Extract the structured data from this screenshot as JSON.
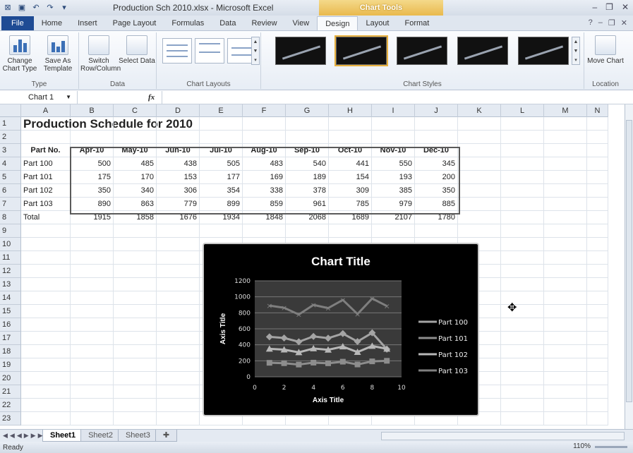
{
  "window": {
    "title": "Production Sch 2010.xlsx - Microsoft Excel",
    "contextual_tab_group": "Chart Tools",
    "controls": [
      "–",
      "❐",
      "✕"
    ]
  },
  "ribbon_tabs": [
    "File",
    "Home",
    "Insert",
    "Page Layout",
    "Formulas",
    "Data",
    "Review",
    "View",
    "Design",
    "Layout",
    "Format"
  ],
  "active_tab": "Design",
  "ribbon": {
    "type_group": {
      "label": "Type",
      "buttons": [
        "Change Chart Type",
        "Save As Template"
      ]
    },
    "data_group": {
      "label": "Data",
      "buttons": [
        "Switch Row/Column",
        "Select Data"
      ]
    },
    "layouts_group": {
      "label": "Chart Layouts"
    },
    "styles_group": {
      "label": "Chart Styles"
    },
    "location_group": {
      "label": "Location",
      "buttons": [
        "Move Chart"
      ]
    }
  },
  "formula_bar": {
    "name_box": "Chart 1",
    "fx": "fx",
    "value": ""
  },
  "columns": [
    "A",
    "B",
    "C",
    "D",
    "E",
    "F",
    "G",
    "H",
    "I",
    "J",
    "K",
    "L",
    "M",
    "N"
  ],
  "sheet": {
    "title": "Production Schedule for 2010",
    "headers": [
      "Part No.",
      "Apr-10",
      "May-10",
      "Jun-10",
      "Jul-10",
      "Aug-10",
      "Sep-10",
      "Oct-10",
      "Nov-10",
      "Dec-10"
    ],
    "rows": [
      [
        "Part 100",
        "500",
        "485",
        "438",
        "505",
        "483",
        "540",
        "441",
        "550",
        "345"
      ],
      [
        "Part 101",
        "175",
        "170",
        "153",
        "177",
        "169",
        "189",
        "154",
        "193",
        "200"
      ],
      [
        "Part 102",
        "350",
        "340",
        "306",
        "354",
        "338",
        "378",
        "309",
        "385",
        "350"
      ],
      [
        "Part 103",
        "890",
        "863",
        "779",
        "899",
        "859",
        "961",
        "785",
        "979",
        "885"
      ],
      [
        "Total",
        "1915",
        "1858",
        "1676",
        "1934",
        "1848",
        "2068",
        "1689",
        "2107",
        "1780"
      ]
    ],
    "row_numbers": [
      "1",
      "2",
      "3",
      "4",
      "5",
      "6",
      "7",
      "8",
      "9",
      "10",
      "11",
      "12",
      "13",
      "14",
      "15",
      "16",
      "17",
      "18",
      "19",
      "20",
      "21",
      "22",
      "23"
    ]
  },
  "chart_data": {
    "type": "line",
    "title": "Chart Title",
    "xlabel": "Axis Title",
    "ylabel": "Axis Title",
    "x_ticks": [
      "0",
      "2",
      "4",
      "6",
      "8",
      "10"
    ],
    "y_ticks": [
      "0",
      "200",
      "400",
      "600",
      "800",
      "1000",
      "1200"
    ],
    "xlim": [
      0,
      10
    ],
    "ylim": [
      0,
      1200
    ],
    "x": [
      1,
      2,
      3,
      4,
      5,
      6,
      7,
      8,
      9
    ],
    "series": [
      {
        "name": "Part 100",
        "values": [
          500,
          485,
          438,
          505,
          483,
          540,
          441,
          550,
          345
        ]
      },
      {
        "name": "Part 101",
        "values": [
          175,
          170,
          153,
          177,
          169,
          189,
          154,
          193,
          200
        ]
      },
      {
        "name": "Part 102",
        "values": [
          350,
          340,
          306,
          354,
          338,
          378,
          309,
          385,
          350
        ]
      },
      {
        "name": "Part 103",
        "values": [
          890,
          863,
          779,
          899,
          859,
          961,
          785,
          979,
          885
        ]
      }
    ],
    "legend": "right",
    "grid": true
  },
  "sheet_tabs": [
    "Sheet1",
    "Sheet2",
    "Sheet3"
  ],
  "status": {
    "mode": "Ready",
    "zoom": "110%"
  }
}
